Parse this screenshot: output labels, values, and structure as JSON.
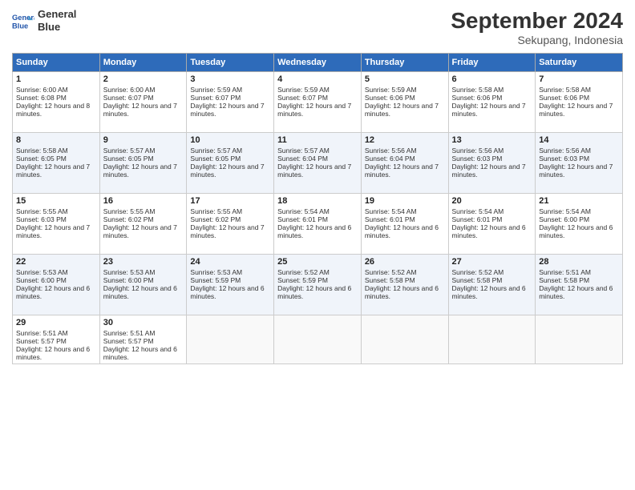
{
  "header": {
    "logo_line1": "General",
    "logo_line2": "Blue",
    "month": "September 2024",
    "location": "Sekupang, Indonesia"
  },
  "days_of_week": [
    "Sunday",
    "Monday",
    "Tuesday",
    "Wednesday",
    "Thursday",
    "Friday",
    "Saturday"
  ],
  "weeks": [
    [
      {
        "day": "1",
        "sunrise": "Sunrise: 6:00 AM",
        "sunset": "Sunset: 6:08 PM",
        "daylight": "Daylight: 12 hours and 8 minutes."
      },
      {
        "day": "2",
        "sunrise": "Sunrise: 6:00 AM",
        "sunset": "Sunset: 6:07 PM",
        "daylight": "Daylight: 12 hours and 7 minutes."
      },
      {
        "day": "3",
        "sunrise": "Sunrise: 5:59 AM",
        "sunset": "Sunset: 6:07 PM",
        "daylight": "Daylight: 12 hours and 7 minutes."
      },
      {
        "day": "4",
        "sunrise": "Sunrise: 5:59 AM",
        "sunset": "Sunset: 6:07 PM",
        "daylight": "Daylight: 12 hours and 7 minutes."
      },
      {
        "day": "5",
        "sunrise": "Sunrise: 5:59 AM",
        "sunset": "Sunset: 6:06 PM",
        "daylight": "Daylight: 12 hours and 7 minutes."
      },
      {
        "day": "6",
        "sunrise": "Sunrise: 5:58 AM",
        "sunset": "Sunset: 6:06 PM",
        "daylight": "Daylight: 12 hours and 7 minutes."
      },
      {
        "day": "7",
        "sunrise": "Sunrise: 5:58 AM",
        "sunset": "Sunset: 6:06 PM",
        "daylight": "Daylight: 12 hours and 7 minutes."
      }
    ],
    [
      {
        "day": "8",
        "sunrise": "Sunrise: 5:58 AM",
        "sunset": "Sunset: 6:05 PM",
        "daylight": "Daylight: 12 hours and 7 minutes."
      },
      {
        "day": "9",
        "sunrise": "Sunrise: 5:57 AM",
        "sunset": "Sunset: 6:05 PM",
        "daylight": "Daylight: 12 hours and 7 minutes."
      },
      {
        "day": "10",
        "sunrise": "Sunrise: 5:57 AM",
        "sunset": "Sunset: 6:05 PM",
        "daylight": "Daylight: 12 hours and 7 minutes."
      },
      {
        "day": "11",
        "sunrise": "Sunrise: 5:57 AM",
        "sunset": "Sunset: 6:04 PM",
        "daylight": "Daylight: 12 hours and 7 minutes."
      },
      {
        "day": "12",
        "sunrise": "Sunrise: 5:56 AM",
        "sunset": "Sunset: 6:04 PM",
        "daylight": "Daylight: 12 hours and 7 minutes."
      },
      {
        "day": "13",
        "sunrise": "Sunrise: 5:56 AM",
        "sunset": "Sunset: 6:03 PM",
        "daylight": "Daylight: 12 hours and 7 minutes."
      },
      {
        "day": "14",
        "sunrise": "Sunrise: 5:56 AM",
        "sunset": "Sunset: 6:03 PM",
        "daylight": "Daylight: 12 hours and 7 minutes."
      }
    ],
    [
      {
        "day": "15",
        "sunrise": "Sunrise: 5:55 AM",
        "sunset": "Sunset: 6:03 PM",
        "daylight": "Daylight: 12 hours and 7 minutes."
      },
      {
        "day": "16",
        "sunrise": "Sunrise: 5:55 AM",
        "sunset": "Sunset: 6:02 PM",
        "daylight": "Daylight: 12 hours and 7 minutes."
      },
      {
        "day": "17",
        "sunrise": "Sunrise: 5:55 AM",
        "sunset": "Sunset: 6:02 PM",
        "daylight": "Daylight: 12 hours and 7 minutes."
      },
      {
        "day": "18",
        "sunrise": "Sunrise: 5:54 AM",
        "sunset": "Sunset: 6:01 PM",
        "daylight": "Daylight: 12 hours and 6 minutes."
      },
      {
        "day": "19",
        "sunrise": "Sunrise: 5:54 AM",
        "sunset": "Sunset: 6:01 PM",
        "daylight": "Daylight: 12 hours and 6 minutes."
      },
      {
        "day": "20",
        "sunrise": "Sunrise: 5:54 AM",
        "sunset": "Sunset: 6:01 PM",
        "daylight": "Daylight: 12 hours and 6 minutes."
      },
      {
        "day": "21",
        "sunrise": "Sunrise: 5:54 AM",
        "sunset": "Sunset: 6:00 PM",
        "daylight": "Daylight: 12 hours and 6 minutes."
      }
    ],
    [
      {
        "day": "22",
        "sunrise": "Sunrise: 5:53 AM",
        "sunset": "Sunset: 6:00 PM",
        "daylight": "Daylight: 12 hours and 6 minutes."
      },
      {
        "day": "23",
        "sunrise": "Sunrise: 5:53 AM",
        "sunset": "Sunset: 6:00 PM",
        "daylight": "Daylight: 12 hours and 6 minutes."
      },
      {
        "day": "24",
        "sunrise": "Sunrise: 5:53 AM",
        "sunset": "Sunset: 5:59 PM",
        "daylight": "Daylight: 12 hours and 6 minutes."
      },
      {
        "day": "25",
        "sunrise": "Sunrise: 5:52 AM",
        "sunset": "Sunset: 5:59 PM",
        "daylight": "Daylight: 12 hours and 6 minutes."
      },
      {
        "day": "26",
        "sunrise": "Sunrise: 5:52 AM",
        "sunset": "Sunset: 5:58 PM",
        "daylight": "Daylight: 12 hours and 6 minutes."
      },
      {
        "day": "27",
        "sunrise": "Sunrise: 5:52 AM",
        "sunset": "Sunset: 5:58 PM",
        "daylight": "Daylight: 12 hours and 6 minutes."
      },
      {
        "day": "28",
        "sunrise": "Sunrise: 5:51 AM",
        "sunset": "Sunset: 5:58 PM",
        "daylight": "Daylight: 12 hours and 6 minutes."
      }
    ],
    [
      {
        "day": "29",
        "sunrise": "Sunrise: 5:51 AM",
        "sunset": "Sunset: 5:57 PM",
        "daylight": "Daylight: 12 hours and 6 minutes."
      },
      {
        "day": "30",
        "sunrise": "Sunrise: 5:51 AM",
        "sunset": "Sunset: 5:57 PM",
        "daylight": "Daylight: 12 hours and 6 minutes."
      },
      {
        "day": "",
        "sunrise": "",
        "sunset": "",
        "daylight": ""
      },
      {
        "day": "",
        "sunrise": "",
        "sunset": "",
        "daylight": ""
      },
      {
        "day": "",
        "sunrise": "",
        "sunset": "",
        "daylight": ""
      },
      {
        "day": "",
        "sunrise": "",
        "sunset": "",
        "daylight": ""
      },
      {
        "day": "",
        "sunrise": "",
        "sunset": "",
        "daylight": ""
      }
    ]
  ]
}
